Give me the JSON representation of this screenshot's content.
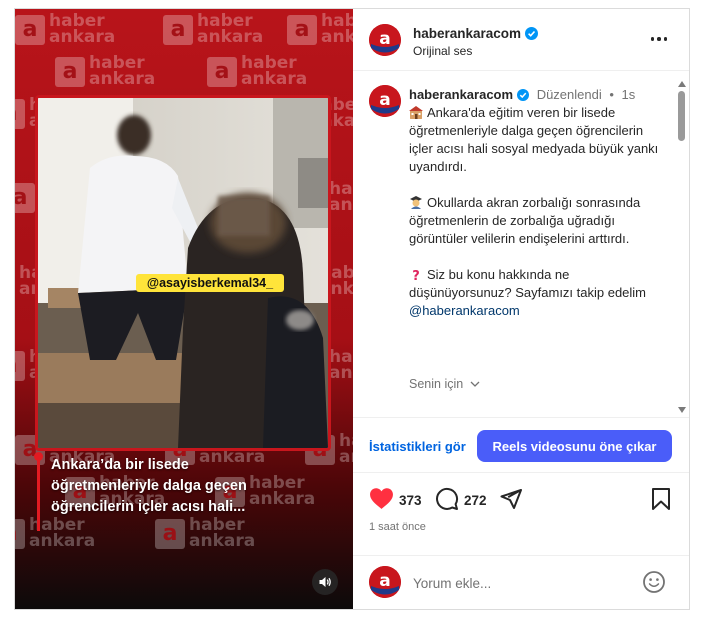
{
  "post": {
    "username": "haberankaracom",
    "audio_label": "Orijinal ses",
    "verified": true
  },
  "media": {
    "watermark_line1": "haber",
    "watermark_line2": "ankara",
    "watermark_letter": "a",
    "video_tag": "@asayisberkemal34_",
    "caption_lines": [
      "Ankara’da bir lisede",
      "öğretmenleriyle dalga geçen",
      "öğrencilerin içler acısı hali..."
    ],
    "sound_icon": "speaker-icon"
  },
  "caption_comment": {
    "username": "haberankaracom",
    "edited": "Düzenlendi",
    "separator": "•",
    "age": "1s",
    "paragraph1": "Ankara'da eğitim veren bir lisede öğretmenleriyle dalga geçen öğrencilerin içler acısı hali sosyal medyada büyük yankı uyandırdı.",
    "paragraph2": "Okullarda akran zorbalığı sonrasında öğretmenlerin de zorbalığa uğradığı görüntüler velilerin endişelerini arttırdı.",
    "paragraph3_text": "Siz bu konu hakkında ne düşünüyorsunuz? Sayfamızı takip edelim",
    "mention": "@haberankaracom",
    "for_you": "Senin için"
  },
  "actions": {
    "stats_label": "İstatistikleri gör",
    "boost_label": "Reels videosunu öne çıkar",
    "likes": "373",
    "comments": "272",
    "time_ago": "1 saat önce"
  },
  "comment_box": {
    "placeholder": "Yorum ekle..."
  },
  "colors": {
    "brand_red": "#c8161d",
    "boost_blue": "#4a5df9",
    "link_blue": "#0064e0",
    "like_red": "#ff3040"
  }
}
